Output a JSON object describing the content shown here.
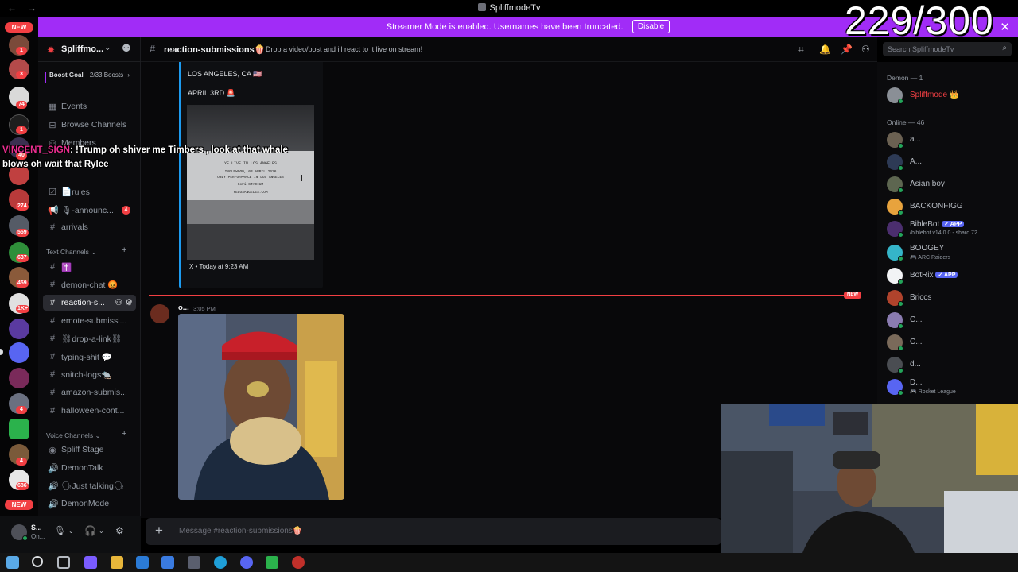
{
  "window": {
    "title": "SpliffmodeTv",
    "back_glyph": "←",
    "forward_glyph": "→"
  },
  "banner": {
    "message": "Streamer Mode is enabled. Usernames have been truncated.",
    "button": "Disable",
    "close_glyph": "✕",
    "color": "#a12cf7"
  },
  "counter": "229/300",
  "rail": {
    "new_label": "NEW",
    "badges": [
      "1",
      "3",
      "74",
      "1",
      "40",
      "274",
      "559",
      "637",
      "459",
      "1K+",
      "4",
      "4",
      "4",
      "686"
    ]
  },
  "guild": {
    "name": "Spliffmo...",
    "boost_goal": "Boost Goal",
    "boost_count": "2/33 Boosts",
    "boost_chevron": "›"
  },
  "sidebar": {
    "top_items": [
      {
        "icon": "calendar-icon",
        "glyph": "▦",
        "label": "Events"
      },
      {
        "icon": "browse-icon",
        "glyph": "⊟",
        "label": "Browse Channels"
      },
      {
        "icon": "members-icon",
        "glyph": "⚇",
        "label": "Members"
      }
    ],
    "channels": [
      {
        "icon": "checkbox-icon",
        "glyph": "☑",
        "label": "📄rules"
      },
      {
        "icon": "announce-icon",
        "glyph": "📢",
        "label": "🎙-announc...",
        "badge": "4"
      },
      {
        "icon": "hash-icon",
        "glyph": "#",
        "label": "arrivals"
      }
    ],
    "text_category": "Text Channels",
    "text_channels": [
      {
        "label": "✝️"
      },
      {
        "label": "demon-chat 😡"
      },
      {
        "label": "reaction-s...",
        "active": true
      },
      {
        "label": "emote-submissi..."
      },
      {
        "label": "⛓drop-a-link⛓"
      },
      {
        "label": "typing-shit 💬"
      },
      {
        "label": "snitch-logs🐀"
      },
      {
        "label": "amazon-submis..."
      },
      {
        "label": "halloween-cont..."
      }
    ],
    "voice_category": "Voice Channels",
    "voice_channels": [
      {
        "label": "Spliff Stage"
      },
      {
        "label": "DemonTalk"
      },
      {
        "label": "🗣Just talking🗣"
      },
      {
        "label": "DemonMode"
      }
    ]
  },
  "user_panel": {
    "name": "S...",
    "status": "On..."
  },
  "chat": {
    "channel": "reaction-submissions🍿",
    "topic": "Drop a video/post and ill react to it live on stream!",
    "search_placeholder": "Search SpliffmodeTv",
    "embed": {
      "line1": "LOS ANGELES, CA 🇺🇸",
      "line2": "APRIL 3RD 🚨",
      "poster_lines": [
        "YE LIVE IN LOS ANGELES",
        "INGLEWOOD, 03 APRIL 2026",
        "ONLY PERFORMANCE IN LOS ANGELES",
        "SoFi STADIUM",
        "YELOSANGELES.COM"
      ],
      "footer": "X • Today at 9:23 AM"
    },
    "new_label": "NEW",
    "message": {
      "author": "o...",
      "time": "3:05 PM"
    },
    "composer_placeholder": "Message #reaction-submissions🍿"
  },
  "overlay": {
    "username": "VINCENT_SIGN",
    "text": ": !Trump oh shiver me Timbers , look at that whale blows oh wait that Rylee"
  },
  "members": {
    "demon_header": "Demon — 1",
    "demon_member": "Spliffmode 👑",
    "online_header": "Online — 46",
    "online": [
      {
        "name": "a...",
        "color": "#6b6152"
      },
      {
        "name": "A...",
        "color": "#2d3a55"
      },
      {
        "name": "Asian boy",
        "color": "#5d6650"
      },
      {
        "name": "BACKONFIGG",
        "color": "#e8a33d"
      },
      {
        "name": "BibleBot",
        "app": "✓ APP",
        "sub": "/biblebot v14.0.0 - shard 72",
        "color": "#4b2e6e"
      },
      {
        "name": "BOOGEY",
        "sub": "🎮 ARC Raiders",
        "color": "#35b5c9"
      },
      {
        "name": "BotRix",
        "app": "✓ APP",
        "color": "#f2f3f5"
      },
      {
        "name": "Briccs",
        "color": "#b0432c"
      },
      {
        "name": "C...",
        "color": "#8a7bb0"
      },
      {
        "name": "C...",
        "color": "#7a6a5a"
      },
      {
        "name": "d...",
        "color": "#4a4d52"
      },
      {
        "name": "D...",
        "sub": "🎮 Rocket League",
        "color": "#5865f2"
      }
    ]
  }
}
